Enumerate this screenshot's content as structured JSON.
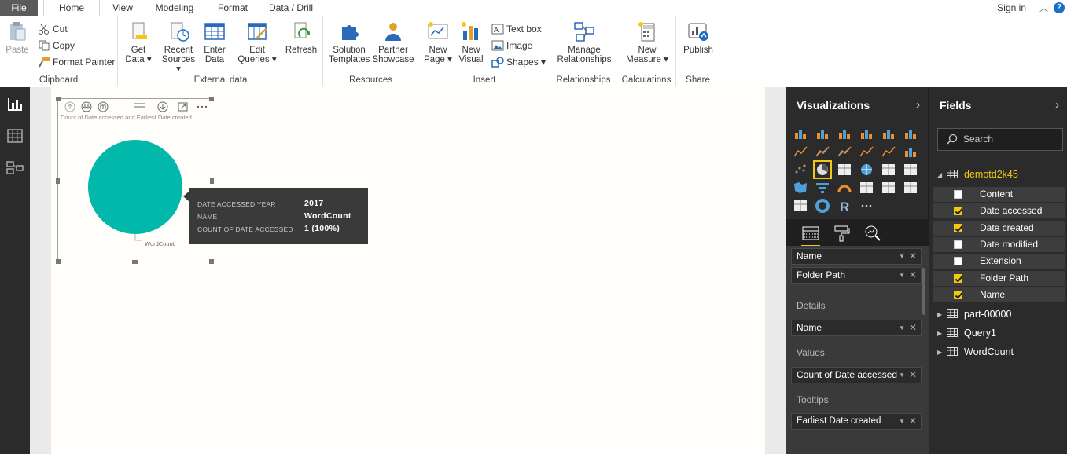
{
  "tabs": [
    "File",
    "Home",
    "View",
    "Modeling",
    "Format",
    "Data / Drill"
  ],
  "active_tab": "Home",
  "account": {
    "signin": "Sign in",
    "help": "?"
  },
  "ribbon": {
    "clipboard": {
      "label": "Clipboard",
      "paste": "Paste",
      "cut": "Cut",
      "copy": "Copy",
      "format_painter": "Format Painter"
    },
    "external_data": {
      "label": "External data",
      "get_data": [
        "Get",
        "Data ▾"
      ],
      "recent_sources": [
        "Recent",
        "Sources ▾"
      ],
      "enter_data": [
        "Enter",
        "Data"
      ],
      "edit_queries": [
        "Edit",
        "Queries ▾"
      ],
      "refresh": [
        "Refresh",
        ""
      ]
    },
    "resources": {
      "label": "Resources",
      "solution_templates": [
        "Solution",
        "Templates"
      ],
      "partner_showcase": [
        "Partner",
        "Showcase"
      ]
    },
    "insert": {
      "label": "Insert",
      "new_page": [
        "New",
        "Page ▾"
      ],
      "new_visual": [
        "New",
        "Visual"
      ],
      "text_box": "Text box",
      "image": "Image",
      "shapes": "Shapes ▾"
    },
    "relationships": {
      "label": "Relationships",
      "manage": [
        "Manage",
        "Relationships"
      ]
    },
    "calculations": {
      "label": "Calculations",
      "new_measure": [
        "New",
        "Measure ▾"
      ]
    },
    "share": {
      "label": "Share",
      "publish": [
        "Publish",
        ""
      ]
    }
  },
  "visual": {
    "title": "Count of Date accessed and Earliest Date created...",
    "slice_label": "WordCount",
    "slice_color": "#01b8aa"
  },
  "tooltip": [
    {
      "key": "DATE ACCESSED YEAR",
      "value": "2017"
    },
    {
      "key": "NAME",
      "value": "WordCount"
    },
    {
      "key": "COUNT OF DATE ACCESSED",
      "value": "1 (100%)"
    }
  ],
  "visualizations": {
    "title": "Visualizations",
    "wells": {
      "legend_fields": [
        "Name",
        "Folder Path"
      ],
      "details_label": "Details",
      "details_field": "Name",
      "values_label": "Values",
      "values_field": "Count of Date accessed",
      "tooltips_label": "Tooltips",
      "tooltips_field": "Earliest Date created"
    }
  },
  "fields": {
    "title": "Fields",
    "search_placeholder": "Search",
    "tables": [
      {
        "name": "demotd2k45",
        "expanded": true
      },
      {
        "name": "part-00000",
        "expanded": false
      },
      {
        "name": "Query1",
        "expanded": false
      },
      {
        "name": "WordCount",
        "expanded": false
      }
    ],
    "columns": [
      {
        "name": "Content",
        "checked": false
      },
      {
        "name": "Date accessed",
        "checked": true
      },
      {
        "name": "Date created",
        "checked": true
      },
      {
        "name": "Date modified",
        "checked": false
      },
      {
        "name": "Extension",
        "checked": false
      },
      {
        "name": "Folder Path",
        "checked": true
      },
      {
        "name": "Name",
        "checked": true
      }
    ]
  },
  "colors": {
    "accent": "#f2c811",
    "pane_bg": "#2b2b2b",
    "file_tab": "#5b5b5b"
  }
}
